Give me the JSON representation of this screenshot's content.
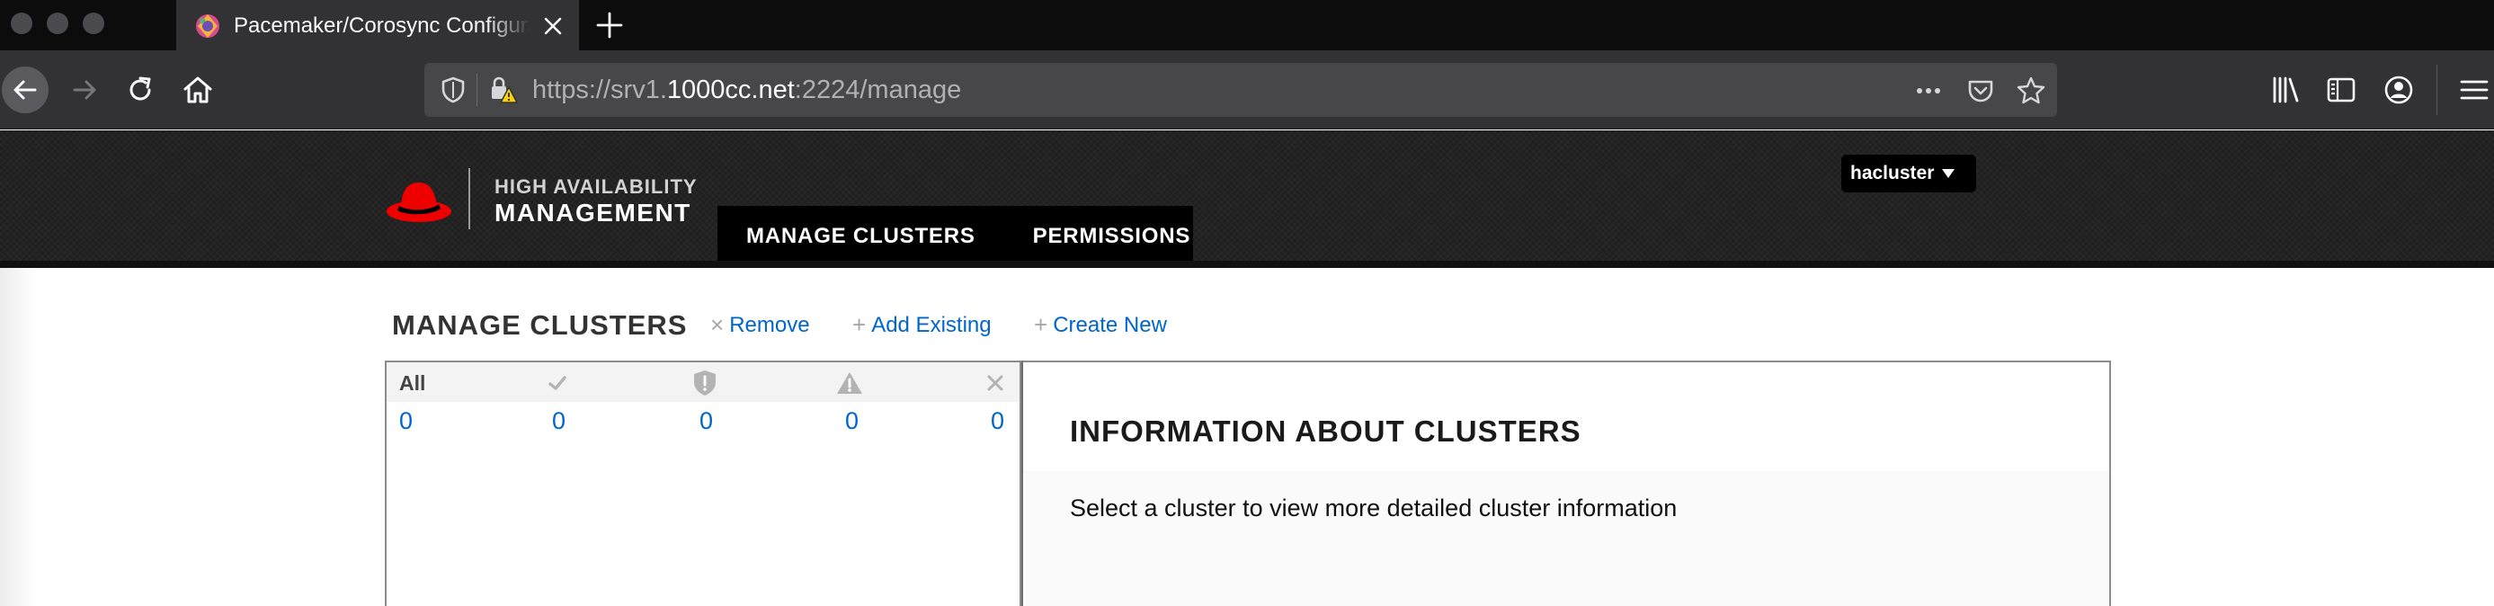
{
  "browser": {
    "tab": {
      "title": "Pacemaker/Corosync Configuration",
      "favicon_icon": "pacemaker-favicon-icon",
      "close_icon": "close-icon"
    },
    "new_tab_icon": "plus-icon",
    "nav": {
      "back_icon": "arrow-left-icon",
      "forward_icon": "arrow-right-icon",
      "reload_icon": "reload-icon",
      "home_icon": "home-icon"
    },
    "url": {
      "prefix": "https://srv1.",
      "domain": "1000cc.net",
      "suffix": ":2224/manage"
    },
    "url_icons": [
      "shield-icon",
      "warning-lock-icon",
      "more-dots-icon",
      "pocket-icon",
      "star-icon"
    ],
    "toolbar_icons": [
      "library-icon",
      "sidebar-icon",
      "account-icon",
      "menu-icon"
    ]
  },
  "header": {
    "logo_line1": "HIGH AVAILABILITY",
    "logo_line2": "MANAGEMENT",
    "brand_color": "#ee0000",
    "nav_items": [
      "MANAGE CLUSTERS",
      "PERMISSIONS"
    ],
    "user": "hacluster"
  },
  "manage": {
    "title": "MANAGE CLUSTERS",
    "actions": [
      {
        "symbol": "×",
        "label": "Remove"
      },
      {
        "symbol": "+",
        "label": "Add Existing"
      },
      {
        "symbol": "+",
        "label": "Create New"
      }
    ],
    "filters": [
      {
        "label": "All",
        "icon": "",
        "count": "0"
      },
      {
        "label": "",
        "icon": "checkmark-icon",
        "count": "0"
      },
      {
        "label": "",
        "icon": "shield-alert-icon",
        "count": "0"
      },
      {
        "label": "",
        "icon": "warning-triangle-icon",
        "count": "0"
      },
      {
        "label": "",
        "icon": "x-icon",
        "count": "0"
      }
    ]
  },
  "info": {
    "title": "INFORMATION ABOUT CLUSTERS",
    "text": "Select a cluster to view more detailed cluster information"
  }
}
